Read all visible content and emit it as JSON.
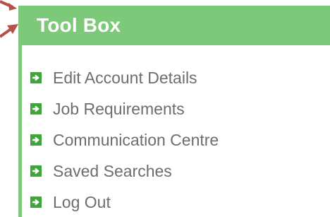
{
  "colors": {
    "panel_green": "#7dc97a",
    "icon_green": "#3fa53a",
    "title_text": "#ffffff",
    "menu_text": "#6d6d6d",
    "annotation_arrow": "#b5504a"
  },
  "toolbox": {
    "title": "Tool Box",
    "items": [
      {
        "label": "Edit Account Details",
        "icon": "plus-square-icon"
      },
      {
        "label": "Job Requirements",
        "icon": "plus-square-icon"
      },
      {
        "label": "Communication Centre",
        "icon": "plus-square-icon"
      },
      {
        "label": "Saved Searches",
        "icon": "plus-square-icon"
      },
      {
        "label": "Log Out",
        "icon": "plus-square-icon"
      }
    ]
  }
}
